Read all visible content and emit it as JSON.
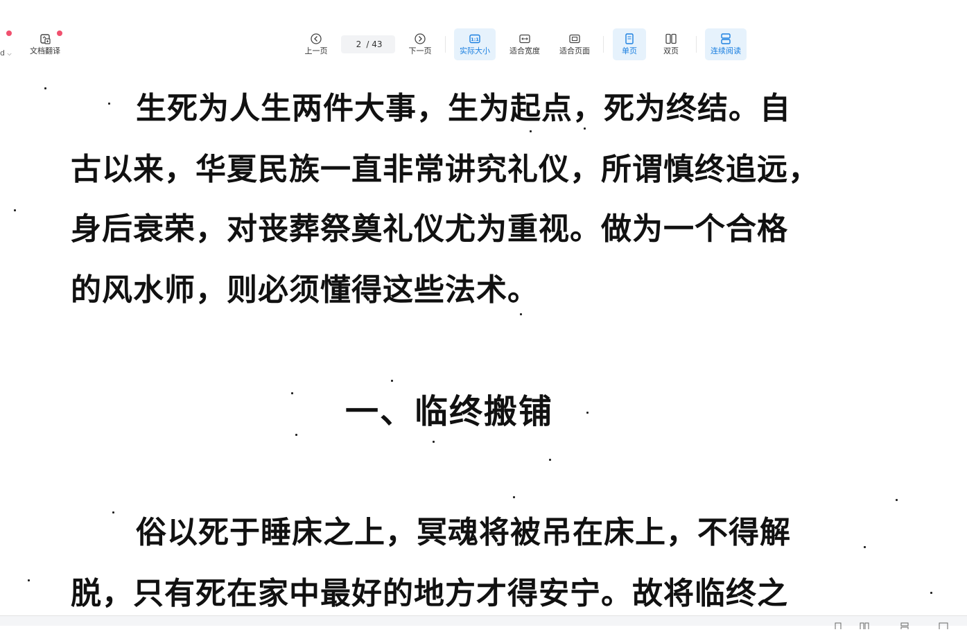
{
  "toolbar": {
    "left_cut_label": "d",
    "doc_translate_label": "文档翻译",
    "prev_page_label": "上一页",
    "next_page_label": "下一页",
    "page_current": "2",
    "page_total": "/ 43",
    "actual_size_label": "实际大小",
    "fit_width_label": "适合宽度",
    "fit_page_label": "适合页面",
    "single_page_label": "单页",
    "double_page_label": "双页",
    "continuous_label": "连续阅读",
    "actual_size_icon_text": "1:1"
  },
  "document": {
    "para1_lines": [
      "生死为人生两件大事，生为起点，死为终结。自",
      "古以来，华夏民族一直非常讲究礼仪，所谓慎终追远，",
      "身后衰荣，对丧葬祭奠礼仪尤为重视。做为一个合格",
      "的风水师，则必须懂得这些法术。"
    ],
    "heading": "一、临终搬铺",
    "para2_lines": [
      "俗以死于睡床之上，冥魂将被吊在床上，不得解",
      "脱，只有死在家中最好的地方才得安宁。故将临终之"
    ]
  },
  "colors": {
    "accent": "#1a7fe0",
    "active_bg": "#e6f2fc",
    "notification_dot": "#f0506e"
  },
  "icons": {
    "doc_translate": "translate-doc-icon",
    "prev": "chevron-left-circle-icon",
    "next": "chevron-right-circle-icon",
    "actual_size": "one-to-one-icon",
    "fit_width": "fit-width-icon",
    "fit_page": "fit-page-icon",
    "single_page": "single-page-icon",
    "double_page": "double-page-icon",
    "continuous": "continuous-read-icon"
  }
}
